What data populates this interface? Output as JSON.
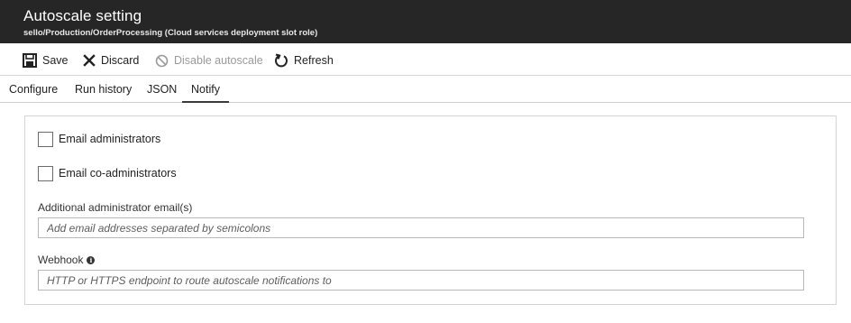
{
  "header": {
    "title": "Autoscale setting",
    "subtitle": "sello/Production/OrderProcessing (Cloud services deployment slot role)"
  },
  "toolbar": {
    "save_label": "Save",
    "discard_label": "Discard",
    "disable_label": "Disable autoscale",
    "refresh_label": "Refresh"
  },
  "tabs": [
    {
      "label": "Configure",
      "active": false
    },
    {
      "label": "Run history",
      "active": false
    },
    {
      "label": "JSON",
      "active": false
    },
    {
      "label": "Notify",
      "active": true
    }
  ],
  "notify": {
    "email_admins_label": "Email administrators",
    "email_admins_checked": false,
    "email_coadmins_label": "Email co-administrators",
    "email_coadmins_checked": false,
    "additional_email_label": "Additional administrator email(s)",
    "additional_email_placeholder": "Add email addresses separated by semicolons",
    "additional_email_value": "",
    "webhook_label": "Webhook",
    "webhook_placeholder": "HTTP or HTTPS endpoint to route autoscale notifications to",
    "webhook_value": ""
  },
  "colors": {
    "header_bg": "#262626",
    "disabled_text": "#9a9a9a"
  }
}
